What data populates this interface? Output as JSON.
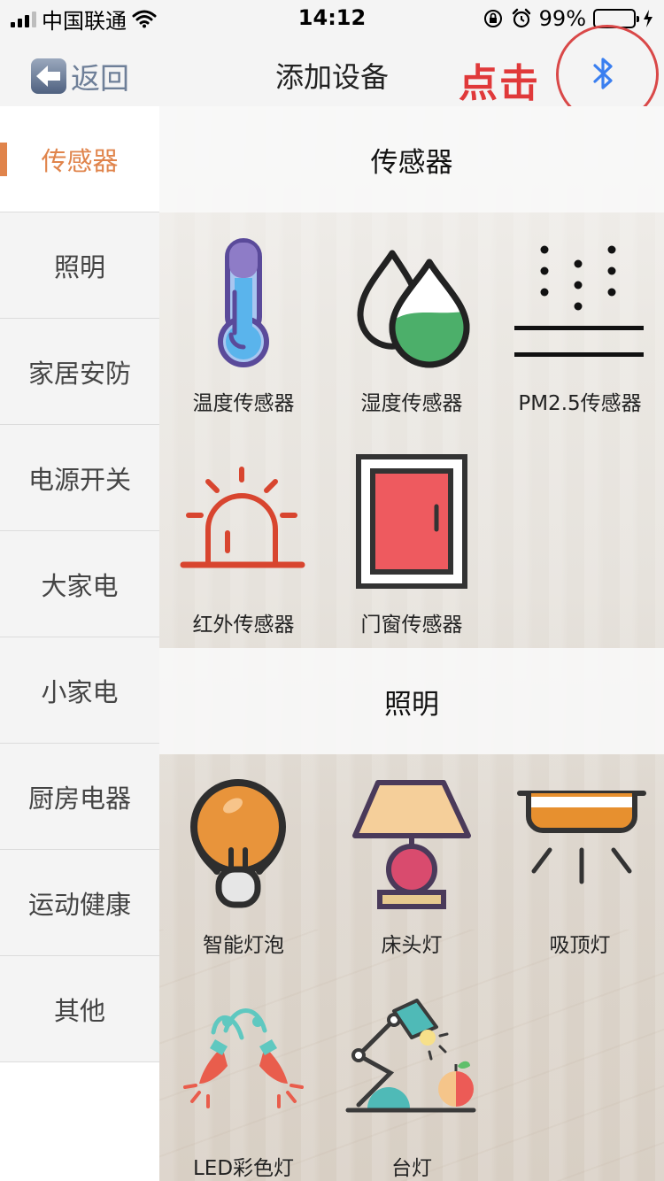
{
  "status_bar": {
    "carrier": "中国联通",
    "time": "14:12",
    "battery_percent": "99%",
    "signal_bars_filled": 3,
    "signal_bars_total": 4
  },
  "nav": {
    "back_label": "返回",
    "title": "添加设备",
    "annotation_label": "点击",
    "annotation_color": "#e0393a",
    "bluetooth_icon": "bluetooth-icon"
  },
  "sidebar": {
    "active_color": "#e0844b",
    "items": [
      {
        "label": "传感器",
        "active": true
      },
      {
        "label": "照明",
        "active": false
      },
      {
        "label": "家居安防",
        "active": false
      },
      {
        "label": "电源开关",
        "active": false
      },
      {
        "label": "大家电",
        "active": false
      },
      {
        "label": "小家电",
        "active": false
      },
      {
        "label": "厨房电器",
        "active": false
      },
      {
        "label": "运动健康",
        "active": false
      },
      {
        "label": "其他",
        "active": false
      }
    ]
  },
  "sections": [
    {
      "title": "传感器",
      "devices": [
        {
          "label": "温度传感器",
          "icon": "thermometer-icon"
        },
        {
          "label": "湿度传感器",
          "icon": "humidity-drops-icon"
        },
        {
          "label": "PM2.5传感器",
          "icon": "pm25-particles-icon"
        },
        {
          "label": "红外传感器",
          "icon": "alarm-beacon-icon"
        },
        {
          "label": "门窗传感器",
          "icon": "door-icon"
        }
      ]
    },
    {
      "title": "照明",
      "devices": [
        {
          "label": "智能灯泡",
          "icon": "light-bulb-icon"
        },
        {
          "label": "床头灯",
          "icon": "bedside-lamp-icon"
        },
        {
          "label": "吸顶灯",
          "icon": "ceiling-lamp-icon"
        },
        {
          "label": "LED彩色灯",
          "icon": "led-string-lights-icon"
        },
        {
          "label": "台灯",
          "icon": "desk-lamp-icon"
        }
      ]
    }
  ]
}
